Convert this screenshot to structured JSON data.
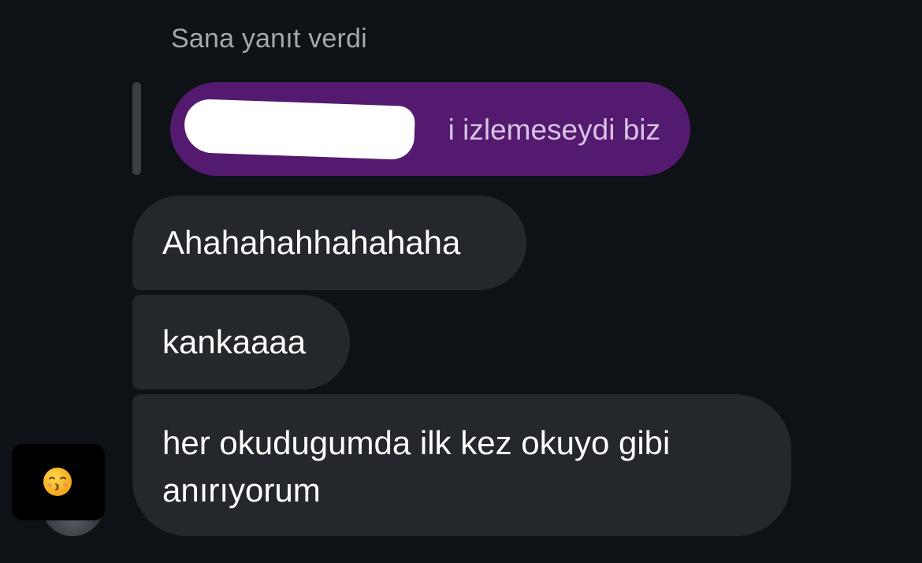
{
  "reply": {
    "header": "Sana yanıt verdi",
    "quoted_text": "i izlemeseydi biz"
  },
  "messages": [
    {
      "text": "Ahahahahhahahaha"
    },
    {
      "text": "kankaaaa"
    },
    {
      "text": "her okudugumda ilk kez okuyo gibi\nanırıyorum"
    }
  ],
  "reaction": {
    "emoji_icon": "kissing-face-smiling-eyes-icon"
  },
  "colors": {
    "background": "#0e1115",
    "quoted_bubble": "#541a6f",
    "message_bubble": "#24282d",
    "header_text": "#a3a8b0"
  }
}
